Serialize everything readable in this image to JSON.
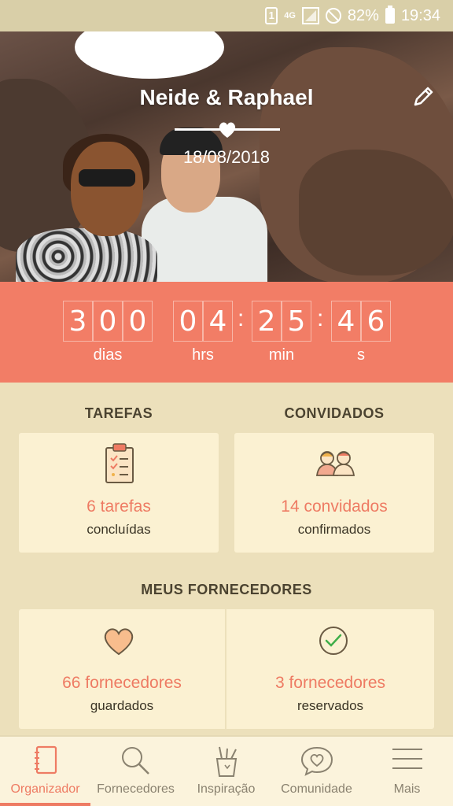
{
  "status_bar": {
    "sim": "1",
    "network": "4G",
    "battery": "82%",
    "time": "19:34"
  },
  "hero": {
    "names": "Neide & Raphael",
    "date": "18/08/2018"
  },
  "countdown": {
    "days_digits": [
      "3",
      "0",
      "0"
    ],
    "hours_digits": [
      "0",
      "4"
    ],
    "minutes_digits": [
      "2",
      "5"
    ],
    "seconds_digits": [
      "4",
      "6"
    ],
    "labels": {
      "days": "dias",
      "hours": "hrs",
      "minutes": "min",
      "seconds": "s"
    }
  },
  "tasks": {
    "heading": "TAREFAS",
    "count": "6 tarefas",
    "sub": "concluídas"
  },
  "guests": {
    "heading": "CONVIDADOS",
    "count": "14 convidados",
    "sub": "confirmados"
  },
  "vendors": {
    "heading": "MEUS FORNECEDORES",
    "saved_count": "66 fornecedores",
    "saved_sub": "guardados",
    "booked_count": "3 fornecedores",
    "booked_sub": "reservados"
  },
  "tabs": [
    {
      "label": "Organizador",
      "icon": "notebook-icon",
      "active": true
    },
    {
      "label": "Fornecedores",
      "icon": "search-icon",
      "active": false
    },
    {
      "label": "Inspiração",
      "icon": "pencil-cup-icon",
      "active": false
    },
    {
      "label": "Comunidade",
      "icon": "chat-heart-icon",
      "active": false
    },
    {
      "label": "Mais",
      "icon": "menu-icon",
      "active": false
    }
  ],
  "colors": {
    "accent": "#ee7b63",
    "countdown_bg": "#f27d66",
    "background": "#ece0bb",
    "card": "#fbf1d2"
  }
}
